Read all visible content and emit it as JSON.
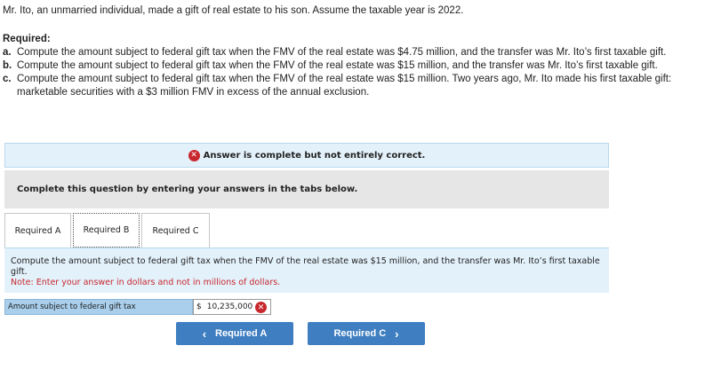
{
  "intro": "Mr. Ito, an unmarried individual, made a gift of real estate to his son. Assume the taxable year is 2022.",
  "required_title": "Required:",
  "parts": [
    {
      "letter": "a.",
      "text": "Compute the amount subject to federal gift tax when the FMV of the real estate was $4.75 million, and the transfer was Mr. Ito’s first taxable gift."
    },
    {
      "letter": "b.",
      "text": "Compute the amount subject to federal gift tax when the FMV of the real estate was $15 million, and the transfer was Mr. Ito’s first taxable gift."
    },
    {
      "letter": "c.",
      "text": "Compute the amount subject to federal gift tax when the FMV of the real estate was $15 million. Two years ago, Mr. Ito made his first taxable gift: marketable securities with a $3 million FMV in excess of the annual exclusion."
    }
  ],
  "banner": {
    "icon": "x-circle-icon",
    "text": "Answer is complete but not entirely correct."
  },
  "instruction": "Complete this question by entering your answers in the tabs below.",
  "tabs": [
    {
      "label": "Required A",
      "active": false
    },
    {
      "label": "Required B",
      "active": true
    },
    {
      "label": "Required C",
      "active": false
    }
  ],
  "question": {
    "text": "Compute the amount subject to federal gift tax when the FMV of the real estate was $15 million, and the transfer was Mr. Ito’s first taxable gift.",
    "note": "Note: Enter your answer in dollars and not in millions of dollars."
  },
  "answer_row": {
    "label": "Amount subject to federal gift tax",
    "currency": "$",
    "value": "10,235,000",
    "status_icon": "x-circle-icon"
  },
  "nav": {
    "prev_label": "Required A",
    "next_label": "Required C"
  },
  "colors": {
    "accent_blue": "#3f7ec1",
    "banner_bg": "#e3f1fb",
    "error_red": "#c8282d",
    "label_bg": "#a9cfec"
  }
}
